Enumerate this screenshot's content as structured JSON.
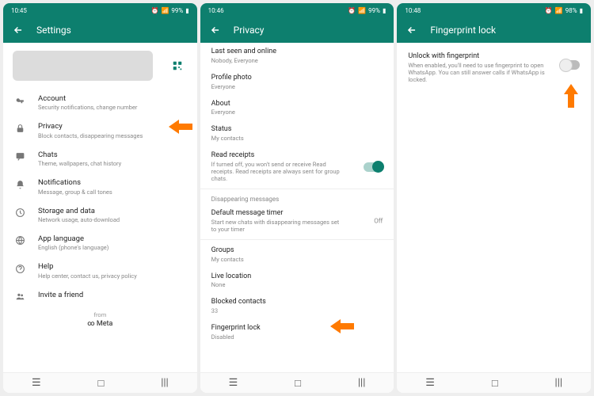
{
  "colors": {
    "brand": "#0d7f6e",
    "arrow": "#ff7a00"
  },
  "screens": [
    {
      "status": {
        "time": "10:45",
        "battery": "99%"
      },
      "title": "Settings",
      "footer": {
        "from": "from",
        "brand": "Meta"
      },
      "items": [
        {
          "icon": "key-icon",
          "label": "Account",
          "sub": "Security notifications, change number"
        },
        {
          "icon": "lock-icon",
          "label": "Privacy",
          "sub": "Block contacts, disappearing messages",
          "arrow": true
        },
        {
          "icon": "chat-icon",
          "label": "Chats",
          "sub": "Theme, wallpapers, chat history"
        },
        {
          "icon": "bell-icon",
          "label": "Notifications",
          "sub": "Message, group & call tones"
        },
        {
          "icon": "data-icon",
          "label": "Storage and data",
          "sub": "Network usage, auto-download"
        },
        {
          "icon": "globe-icon",
          "label": "App language",
          "sub": "English (phone's language)"
        },
        {
          "icon": "help-icon",
          "label": "Help",
          "sub": "Help center, contact us, privacy policy"
        },
        {
          "icon": "people-icon",
          "label": "Invite a friend",
          "sub": ""
        }
      ]
    },
    {
      "status": {
        "time": "10:46",
        "battery": "99%"
      },
      "title": "Privacy",
      "section_header": "Disappearing messages",
      "items": [
        {
          "label": "Last seen and online",
          "sub": "Nobody, Everyone"
        },
        {
          "label": "Profile photo",
          "sub": "Everyone"
        },
        {
          "label": "About",
          "sub": "Everyone"
        },
        {
          "label": "Status",
          "sub": "My contacts"
        },
        {
          "label": "Read receipts",
          "sub": "If turned off, you won't send or receive Read receipts. Read receipts are always sent for group chats.",
          "toggle": "on"
        },
        {
          "divider": true
        },
        {
          "section": true
        },
        {
          "label": "Default message timer",
          "sub": "Start new chats with disappearing messages set to your timer",
          "right": "Off"
        },
        {
          "divider": true
        },
        {
          "label": "Groups",
          "sub": "My contacts"
        },
        {
          "label": "Live location",
          "sub": "None"
        },
        {
          "label": "Blocked contacts",
          "sub": "33"
        },
        {
          "label": "Fingerprint lock",
          "sub": "Disabled",
          "arrow": true
        }
      ]
    },
    {
      "status": {
        "time": "10:48",
        "battery": "98%"
      },
      "title": "Fingerprint lock",
      "items": [
        {
          "label": "Unlock with fingerprint",
          "sub": "When enabled, you'll need to use fingerprint to open WhatsApp. You can still answer calls if WhatsApp is locked.",
          "toggle": "off",
          "arrow": true
        }
      ]
    }
  ]
}
